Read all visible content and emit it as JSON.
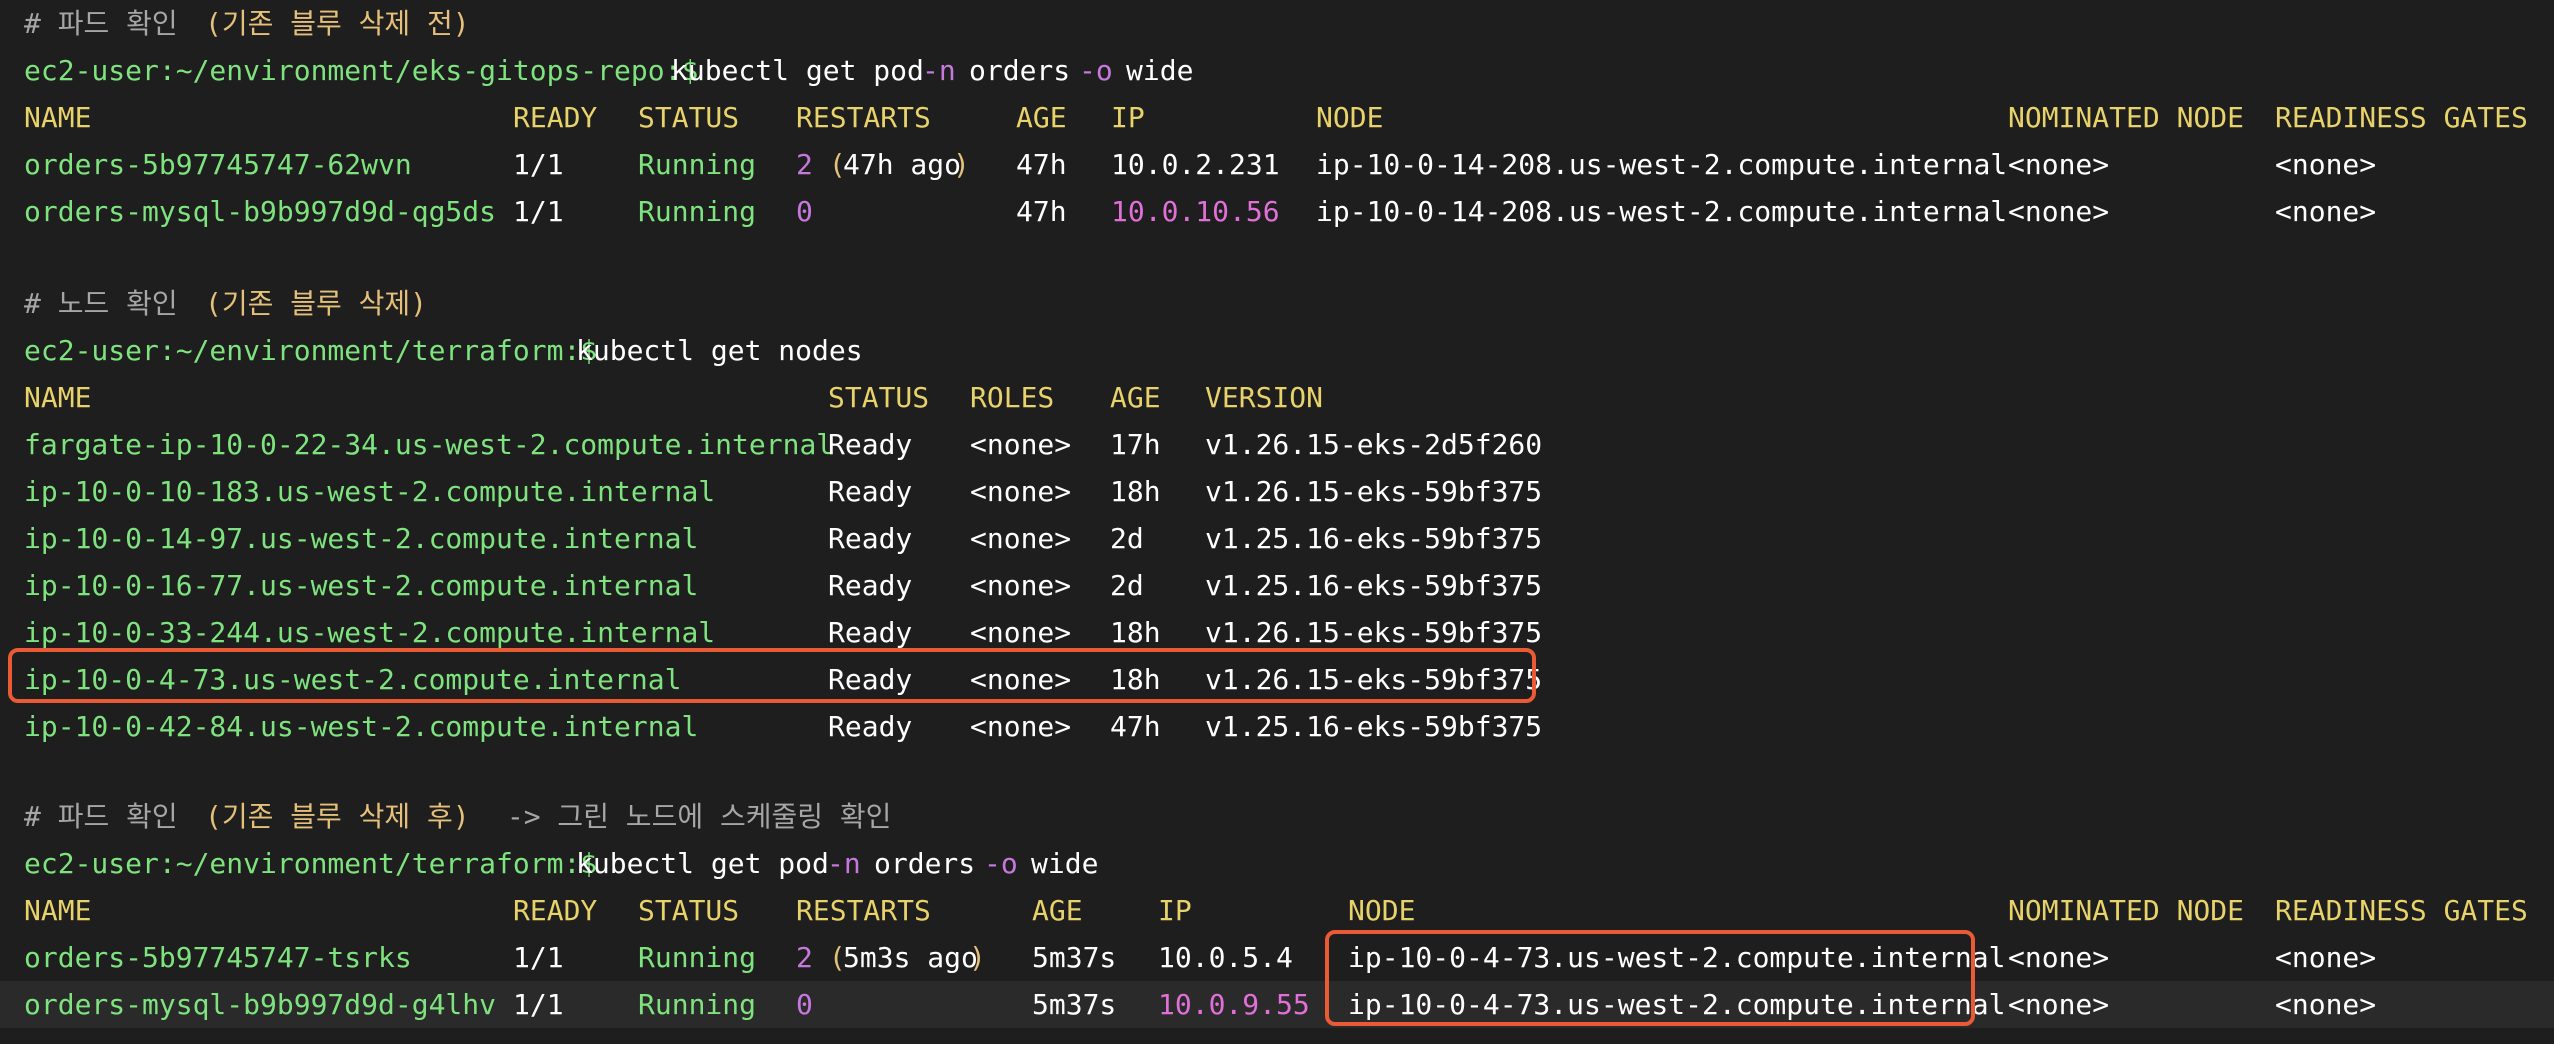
{
  "block1": {
    "comment_prefix": "# 파드 확인",
    "comment_paren": "(기존 블루 삭제 전)",
    "prompt": "ec2-user:~/environment/eks-gitops-repo:$",
    "cmd_kubectl": "kubectl get pod",
    "cmd_flag_n": "-n",
    "cmd_ns": "orders",
    "cmd_flag_o": "-o",
    "cmd_fmt": "wide",
    "headers": [
      "NAME",
      "READY",
      "STATUS",
      "RESTARTS",
      "AGE",
      "IP",
      "NODE",
      "NOMINATED NODE",
      "READINESS GATES"
    ],
    "rows": [
      {
        "name": "orders-5b97745747-62wvn",
        "ready": "1/1",
        "status": "Running",
        "restarts_num": "2",
        "restarts_note_open": " (",
        "restarts_note": "47h ago",
        "restarts_note_close": ")",
        "age": "47h",
        "ip": "10.0.2.231",
        "node": "ip-10-0-14-208.us-west-2.compute.internal",
        "nominated": "<none>",
        "gates": "<none>"
      },
      {
        "name": "orders-mysql-b9b997d9d-qg5ds",
        "ready": "1/1",
        "status": "Running",
        "restarts_num": "0",
        "restarts_note_open": "",
        "restarts_note": "",
        "restarts_note_close": "",
        "age": "47h",
        "ip": "10.0.10.56",
        "node": "ip-10-0-14-208.us-west-2.compute.internal",
        "nominated": "<none>",
        "gates": "<none>"
      }
    ]
  },
  "block2": {
    "comment_prefix": "# 노드 확인",
    "comment_paren": "(기존 블루 삭제)",
    "prompt": "ec2-user:~/environment/terraform:$",
    "cmd": "kubectl get nodes",
    "headers": [
      "NAME",
      "STATUS",
      "ROLES",
      "AGE",
      "VERSION"
    ],
    "rows": [
      {
        "name": "fargate-ip-10-0-22-34.us-west-2.compute.internal",
        "status": "Ready",
        "roles": "<none>",
        "age": "17h",
        "version": "v1.26.15-eks-2d5f260"
      },
      {
        "name": "ip-10-0-10-183.us-west-2.compute.internal",
        "status": "Ready",
        "roles": "<none>",
        "age": "18h",
        "version": "v1.26.15-eks-59bf375"
      },
      {
        "name": "ip-10-0-14-97.us-west-2.compute.internal",
        "status": "Ready",
        "roles": "<none>",
        "age": "2d",
        "version": "v1.25.16-eks-59bf375"
      },
      {
        "name": "ip-10-0-16-77.us-west-2.compute.internal",
        "status": "Ready",
        "roles": "<none>",
        "age": "2d",
        "version": "v1.25.16-eks-59bf375"
      },
      {
        "name": "ip-10-0-33-244.us-west-2.compute.internal",
        "status": "Ready",
        "roles": "<none>",
        "age": "18h",
        "version": "v1.26.15-eks-59bf375"
      },
      {
        "name": "ip-10-0-4-73.us-west-2.compute.internal",
        "status": "Ready",
        "roles": "<none>",
        "age": "18h",
        "version": "v1.26.15-eks-59bf375"
      },
      {
        "name": "ip-10-0-42-84.us-west-2.compute.internal",
        "status": "Ready",
        "roles": "<none>",
        "age": "47h",
        "version": "v1.25.16-eks-59bf375"
      }
    ]
  },
  "block3": {
    "comment_prefix": "# 파드 확인",
    "comment_paren": "(기존 블루 삭제 후)",
    "comment_suffix": " -> 그린 노드에 스케줄링 확인",
    "prompt": "ec2-user:~/environment/terraform:$",
    "cmd_kubectl": "kubectl get pod",
    "cmd_flag_n": "-n",
    "cmd_ns": "orders",
    "cmd_flag_o": "-o",
    "cmd_fmt": "wide",
    "headers": [
      "NAME",
      "READY",
      "STATUS",
      "RESTARTS",
      "AGE",
      "IP",
      "NODE",
      "NOMINATED NODE",
      "READINESS GATES"
    ],
    "rows": [
      {
        "name": "orders-5b97745747-tsrks",
        "ready": "1/1",
        "status": "Running",
        "restarts_num": "2",
        "restarts_note_open": " (",
        "restarts_note": "5m3s ago",
        "restarts_note_close": ")",
        "age": "5m37s",
        "ip": "10.0.5.4",
        "node": "ip-10-0-4-73.us-west-2.compute.internal",
        "nominated": "<none>",
        "gates": "<none>"
      },
      {
        "name": "orders-mysql-b9b997d9d-g4lhv",
        "ready": "1/1",
        "status": "Running",
        "restarts_num": "0",
        "restarts_note_open": "",
        "restarts_note": "",
        "restarts_note_close": "",
        "age": "5m37s",
        "ip": "10.0.9.55",
        "node": "ip-10-0-4-73.us-west-2.compute.internal",
        "nominated": "<none>",
        "gates": "<none>"
      }
    ]
  },
  "colors": {
    "background": "#1e1e1e",
    "prompt": "#7ee37e",
    "header": "#e8d26a",
    "highlight_box": "#ea5a35",
    "number": "#c678dd"
  }
}
